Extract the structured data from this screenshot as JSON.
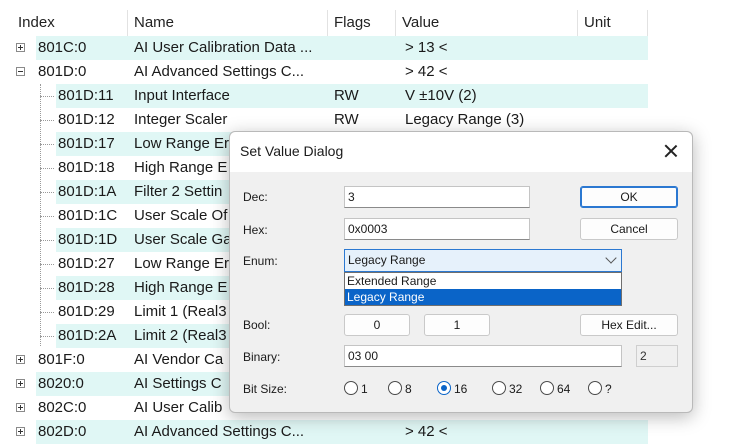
{
  "table": {
    "columns": [
      "Index",
      "Name",
      "Flags",
      "Value",
      "Unit"
    ],
    "rows": [
      {
        "index": "801C:0",
        "name": "AI User Calibration Data ...",
        "flags": "",
        "value": "> 13 <",
        "level": 0,
        "expander": "plus",
        "highlight": true
      },
      {
        "index": "801D:0",
        "name": "AI Advanced Settings C...",
        "flags": "",
        "value": "> 42 <",
        "level": 0,
        "expander": "minus",
        "highlight": false
      },
      {
        "index": "801D:11",
        "name": "Input Interface",
        "flags": "RW",
        "value": "V ±10V (2)",
        "level": 1,
        "highlight": true
      },
      {
        "index": "801D:12",
        "name": "Integer Scaler",
        "flags": "RW",
        "value": "Legacy Range (3)",
        "level": 1,
        "highlight": false
      },
      {
        "index": "801D:17",
        "name": "Low Range Er",
        "flags": "",
        "value": "",
        "level": 1,
        "highlight": true
      },
      {
        "index": "801D:18",
        "name": "High Range E",
        "flags": "",
        "value": "",
        "level": 1,
        "highlight": false
      },
      {
        "index": "801D:1A",
        "name": "Filter 2 Settin",
        "flags": "",
        "value": "",
        "level": 1,
        "highlight": true
      },
      {
        "index": "801D:1C",
        "name": "User Scale Of",
        "flags": "",
        "value": "",
        "level": 1,
        "highlight": false
      },
      {
        "index": "801D:1D",
        "name": "User Scale Ga",
        "flags": "",
        "value": "",
        "level": 1,
        "highlight": true
      },
      {
        "index": "801D:27",
        "name": "Low Range Er",
        "flags": "",
        "value": "",
        "level": 1,
        "highlight": false
      },
      {
        "index": "801D:28",
        "name": "High Range E",
        "flags": "",
        "value": "",
        "level": 1,
        "highlight": true
      },
      {
        "index": "801D:29",
        "name": "Limit 1 (Real3",
        "flags": "",
        "value": "",
        "level": 1,
        "highlight": false
      },
      {
        "index": "801D:2A",
        "name": "Limit 2 (Real3",
        "flags": "",
        "value": "",
        "level": 1,
        "highlight": true
      },
      {
        "index": "801F:0",
        "name": "AI Vendor Ca",
        "flags": "",
        "value": "",
        "level": 0,
        "expander": "plus",
        "highlight": false
      },
      {
        "index": "8020:0",
        "name": "AI Settings C",
        "flags": "",
        "value": "",
        "level": 0,
        "expander": "plus",
        "highlight": true
      },
      {
        "index": "802C:0",
        "name": "AI User Calib",
        "flags": "",
        "value": "",
        "level": 0,
        "expander": "plus",
        "highlight": false
      },
      {
        "index": "802D:0",
        "name": "AI Advanced Settings C...",
        "flags": "",
        "value": "> 42 <",
        "level": 0,
        "expander": "plus",
        "highlight": true
      }
    ]
  },
  "dialog": {
    "title": "Set Value Dialog",
    "dec_label": "Dec:",
    "dec_value": "3",
    "hex_label": "Hex:",
    "hex_value": "0x0003",
    "enum_label": "Enum:",
    "enum_selected": "Legacy Range",
    "enum_options": [
      "Extended Range",
      "Legacy Range"
    ],
    "bool_label": "Bool:",
    "bool_false": "0",
    "bool_true": "1",
    "binary_label": "Binary:",
    "binary_value": "03 00",
    "binary_length": "2",
    "bitsize_label": "Bit Size:",
    "bitsize_options": [
      "1",
      "8",
      "16",
      "32",
      "64",
      "?"
    ],
    "bitsize_selected": "16",
    "ok_label": "OK",
    "cancel_label": "Cancel",
    "hex_edit_label": "Hex Edit..."
  },
  "colors": {
    "row_highlight": "#e0f7f5",
    "selection_blue": "#0a64c8",
    "default_button_border": "#2b78d1",
    "dialog_bg": "#f0f0f0"
  },
  "icons": {
    "expand": "plus-box-icon",
    "collapse": "minus-box-icon",
    "close": "close-icon",
    "dropdown": "chevron-down-icon"
  }
}
